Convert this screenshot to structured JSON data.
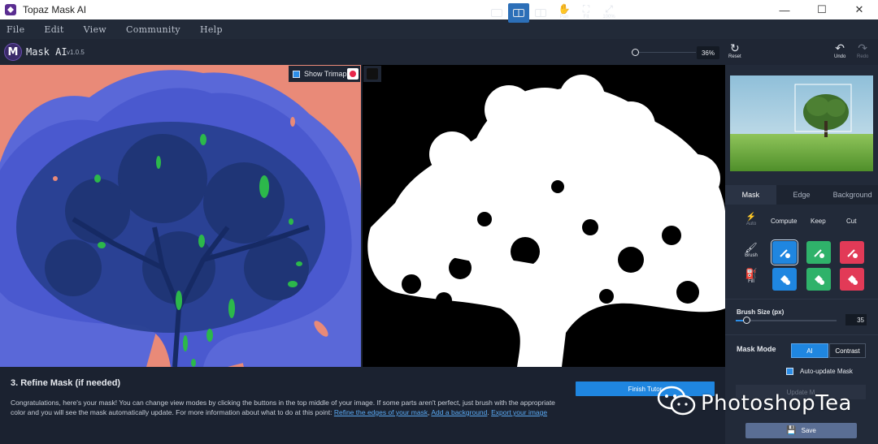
{
  "window": {
    "title": "Topaz Mask AI",
    "min": "—",
    "max": "☐",
    "close": "✕"
  },
  "menu": [
    "File",
    "Edit",
    "View",
    "Community",
    "Help"
  ],
  "toolbar": {
    "logo_letter": "M",
    "app_name": "Mask AI",
    "version": "v1.0.5",
    "pan": "Pan",
    "fit": "Fit",
    "zoom100": "100%",
    "zoom_value": "36%",
    "reset": "Reset",
    "undo": "Undo",
    "redo": "Redo"
  },
  "overlay": {
    "show_trimap": "Show Trimap"
  },
  "right_panel": {
    "tabs": [
      "Mask",
      "Edge",
      "Background"
    ],
    "columns": [
      "Compute",
      "Keep",
      "Cut"
    ],
    "auto_label": "Auto",
    "brush_label": "Brush",
    "fill_label": "Fill",
    "brush_size_label": "Brush Size (px)",
    "brush_size_value": "35",
    "mask_mode_label": "Mask Mode",
    "mode_ai": "AI",
    "mode_contrast": "Contrast",
    "auto_update_label": "Auto-update Mask",
    "update_btn": "Update M",
    "save_btn": "Save"
  },
  "tutorial": {
    "title": "3. Refine Mask (if needed)",
    "body": "Congratulations, here's your mask! You can change view modes by clicking the buttons in the top middle of your image. If some parts aren't perfect, just brush with the appropriate color and you will see the mask automatically update. For more information about what to do at this point: ",
    "link1": "Refine the edges of your mask",
    "sep": ", ",
    "link2": "Add a background",
    "dot": ". ",
    "link3": "Export your image",
    "finish_btn": "Finish Tutor"
  },
  "watermark": {
    "text": "PhotoshopTea"
  },
  "colors": {
    "accent_blue": "#1f86e0",
    "keep_green": "#2fb26a",
    "cut_red": "#e23a57",
    "trimap_blue": "#5a68d8",
    "trimap_salmon": "#e98a78"
  }
}
